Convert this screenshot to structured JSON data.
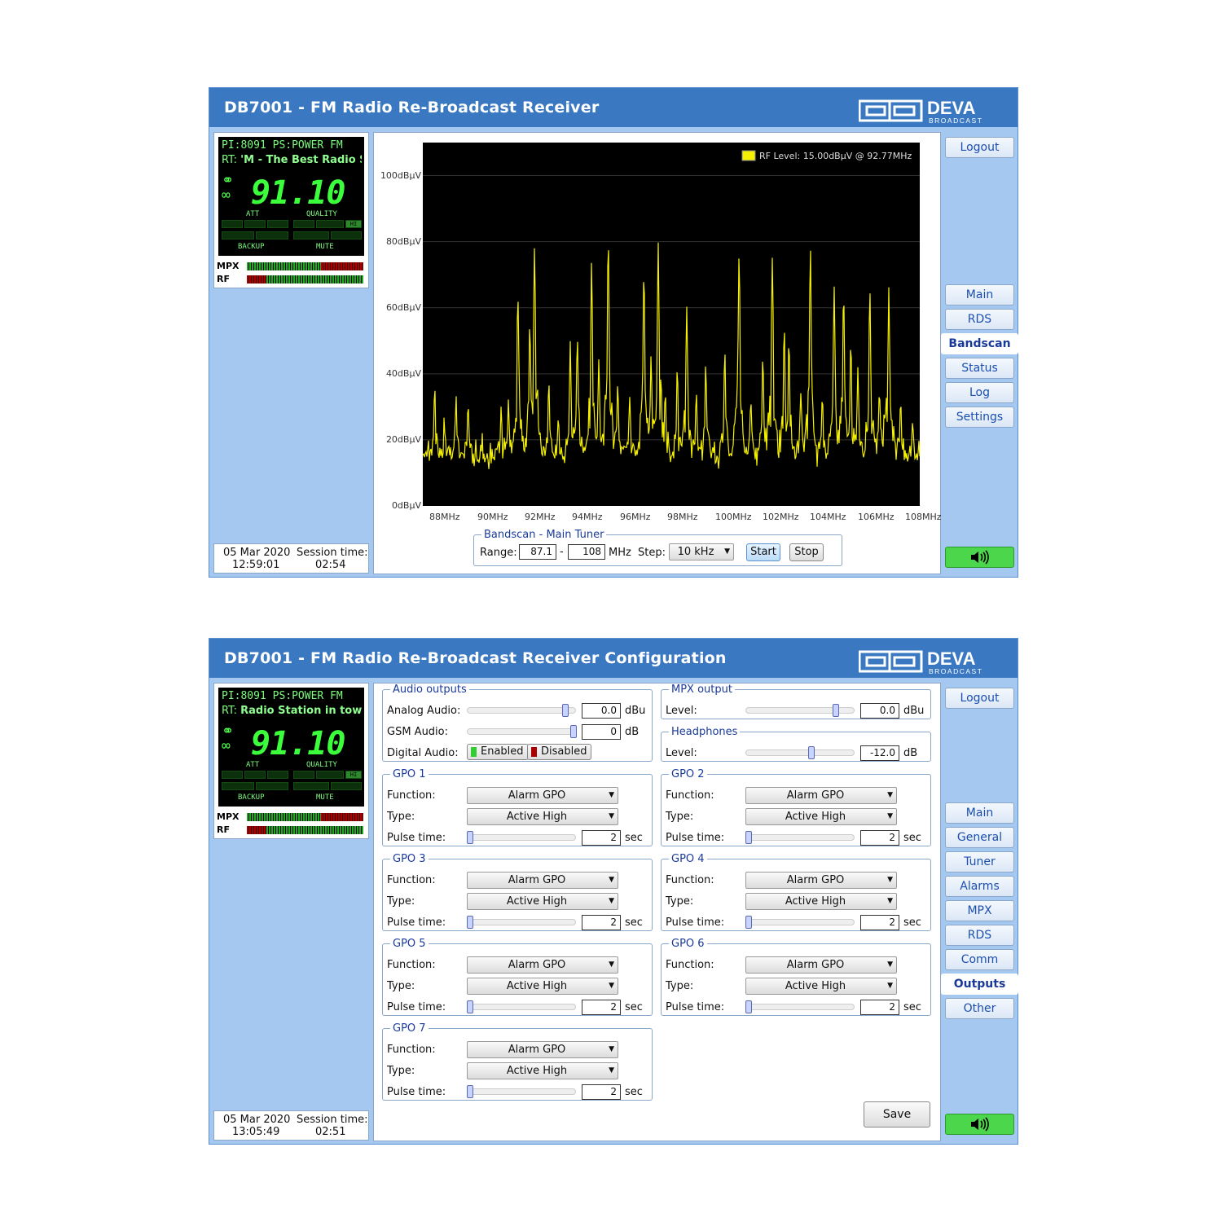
{
  "window1": {
    "title": "DB7001 - FM Radio Re-Broadcast Receiver",
    "logo_text": "DEVA",
    "logo_sub": "BROADCAST",
    "lcd": {
      "pi": "PI:",
      "pi_val": "8091",
      "ps": "PS:",
      "ps_val": "POWER  FM",
      "rt": "RT:",
      "rt_val": "'M - The Best Radio S",
      "freq": "91.10",
      "att": "ATT",
      "quality": "QUALITY",
      "backup": "BACKUP",
      "mute": "MUTE",
      "hi": "HI"
    },
    "meters": {
      "mpx": "MPX",
      "rf": "RF",
      "mpx_level": 0.64,
      "rf_level": 0.17
    },
    "date": "05 Mar 2020",
    "time": "12:59:01",
    "session_label": "Session time:",
    "session": "02:54",
    "nav": {
      "logout": "Logout",
      "items": [
        "Main",
        "RDS",
        "Bandscan",
        "Status",
        "Log",
        "Settings"
      ],
      "active": "Bandscan"
    },
    "bandscan": {
      "legend": "Bandscan - Main Tuner",
      "range_label": "Range:",
      "range_from": "87.1",
      "range_to": "108",
      "mhz": "MHz",
      "step_label": "Step:",
      "step": "10 kHz",
      "start": "Start",
      "stop": "Stop"
    },
    "chart_data": {
      "type": "line",
      "legend_text": "RF Level: 15.00dBµV @ 92.77MHz",
      "y_ticks": [
        "100dBµV",
        "80dBµV",
        "60dBµV",
        "40dBµV",
        "20dBµV",
        "0dBµV"
      ],
      "x_ticks": [
        "88MHz",
        "90MHz",
        "92MHz",
        "94MHz",
        "96MHz",
        "98MHz",
        "100MHz",
        "102MHz",
        "104MHz",
        "106MHz",
        "108MHz"
      ],
      "xlim": [
        87.1,
        108.0
      ],
      "ylim": [
        0,
        110
      ],
      "baseline": 15,
      "line_color": "#f5f000",
      "peaks": [
        [
          87.6,
          36
        ],
        [
          88.0,
          28
        ],
        [
          88.5,
          33
        ],
        [
          89.0,
          30
        ],
        [
          89.6,
          22
        ],
        [
          90.4,
          29
        ],
        [
          90.7,
          32
        ],
        [
          91.1,
          65
        ],
        [
          91.6,
          54
        ],
        [
          91.8,
          79
        ],
        [
          92.4,
          36
        ],
        [
          92.8,
          28
        ],
        [
          93.3,
          48
        ],
        [
          93.6,
          51
        ],
        [
          94.2,
          73
        ],
        [
          94.5,
          44
        ],
        [
          94.9,
          81
        ],
        [
          95.3,
          38
        ],
        [
          95.8,
          35
        ],
        [
          96.4,
          72
        ],
        [
          96.7,
          44
        ],
        [
          97.0,
          80
        ],
        [
          97.3,
          35
        ],
        [
          97.8,
          41
        ],
        [
          98.2,
          60
        ],
        [
          98.6,
          33
        ],
        [
          99.0,
          42
        ],
        [
          99.8,
          47
        ],
        [
          100.4,
          77
        ],
        [
          100.9,
          32
        ],
        [
          101.4,
          45
        ],
        [
          101.8,
          76
        ],
        [
          102.3,
          54
        ],
        [
          102.5,
          51
        ],
        [
          103.0,
          36
        ],
        [
          103.4,
          77
        ],
        [
          103.9,
          33
        ],
        [
          104.4,
          67
        ],
        [
          104.8,
          65
        ],
        [
          105.1,
          49
        ],
        [
          105.4,
          42
        ],
        [
          105.9,
          64
        ],
        [
          106.3,
          36
        ],
        [
          106.5,
          30
        ],
        [
          106.7,
          65
        ],
        [
          107.2,
          32
        ],
        [
          107.7,
          26
        ]
      ]
    }
  },
  "window2": {
    "title": "DB7001 - FM Radio Re-Broadcast Receiver Configuration",
    "logo_text": "DEVA",
    "logo_sub": "BROADCAST",
    "lcd": {
      "pi": "PI:",
      "pi_val": "8091",
      "ps": "PS:",
      "ps_val": "POWER  FM",
      "rt": "RT:",
      "rt_val": "Radio Station in town",
      "freq": "91.10",
      "att": "ATT",
      "quality": "QUALITY",
      "backup": "BACKUP",
      "mute": "MUTE",
      "hi": "HI"
    },
    "meters": {
      "mpx": "MPX",
      "rf": "RF",
      "mpx_level": 0.64,
      "rf_level": 0.17
    },
    "date": "05 Mar 2020",
    "time": "13:05:49",
    "session_label": "Session time:",
    "session": "02:51",
    "nav": {
      "logout": "Logout",
      "items": [
        "Main",
        "General",
        "Tuner",
        "Alarms",
        "MPX",
        "RDS",
        "Comm",
        "Outputs",
        "Other"
      ],
      "active": "Outputs"
    },
    "audio_outputs": {
      "legend": "Audio outputs",
      "analog_label": "Analog Audio:",
      "analog_val": "0.0",
      "analog_unit": "dBu",
      "analog_level": 0.92,
      "gsm_label": "GSM Audio:",
      "gsm_val": "0",
      "gsm_unit": "dB",
      "gsm_level": 1.0,
      "digital_label": "Digital Audio:",
      "enabled": "Enabled",
      "disabled": "Disabled"
    },
    "mpx_output": {
      "legend": "MPX output",
      "level_label": "Level:",
      "val": "0.0",
      "unit": "dBu",
      "level": 0.82
    },
    "headphones": {
      "legend": "Headphones",
      "level_label": "Level:",
      "val": "-12.0",
      "unit": "dB",
      "level": 0.6
    },
    "gpo": [
      {
        "legend": "GPO 1",
        "function_label": "Function:",
        "function": "Alarm GPO",
        "type_label": "Type:",
        "type": "Active High",
        "pulse_label": "Pulse time:",
        "pulse": "2",
        "unit": "sec"
      },
      {
        "legend": "GPO 2",
        "function_label": "Function:",
        "function": "Alarm GPO",
        "type_label": "Type:",
        "type": "Active High",
        "pulse_label": "Pulse time:",
        "pulse": "2",
        "unit": "sec"
      },
      {
        "legend": "GPO 3",
        "function_label": "Function:",
        "function": "Alarm GPO",
        "type_label": "Type:",
        "type": "Active High",
        "pulse_label": "Pulse time:",
        "pulse": "2",
        "unit": "sec"
      },
      {
        "legend": "GPO 4",
        "function_label": "Function:",
        "function": "Alarm GPO",
        "type_label": "Type:",
        "type": "Active High",
        "pulse_label": "Pulse time:",
        "pulse": "2",
        "unit": "sec"
      },
      {
        "legend": "GPO 5",
        "function_label": "Function:",
        "function": "Alarm GPO",
        "type_label": "Type:",
        "type": "Active High",
        "pulse_label": "Pulse time:",
        "pulse": "2",
        "unit": "sec"
      },
      {
        "legend": "GPO 6",
        "function_label": "Function:",
        "function": "Alarm GPO",
        "type_label": "Type:",
        "type": "Active High",
        "pulse_label": "Pulse time:",
        "pulse": "2",
        "unit": "sec"
      },
      {
        "legend": "GPO 7",
        "function_label": "Function:",
        "function": "Alarm GPO",
        "type_label": "Type:",
        "type": "Active High",
        "pulse_label": "Pulse time:",
        "pulse": "2",
        "unit": "sec"
      }
    ],
    "save": "Save"
  }
}
